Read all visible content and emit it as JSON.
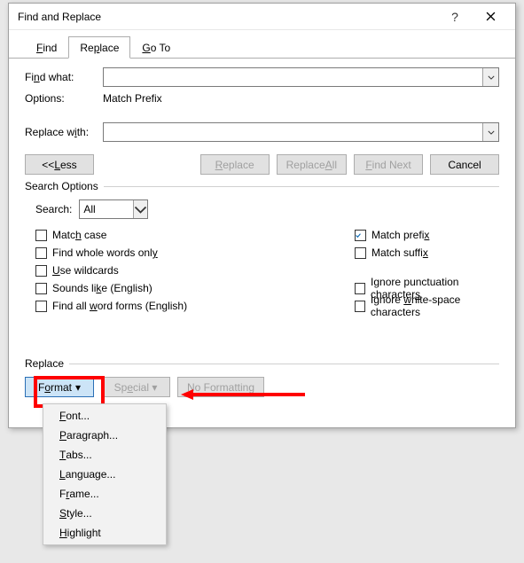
{
  "title": "Find and Replace",
  "tabs": {
    "find": "Find",
    "replace": "Replace",
    "goto": "Go To"
  },
  "findWhat": {
    "label": "Find what:",
    "value": ""
  },
  "optionsLabel": "Options:",
  "optionsValue": "Match Prefix",
  "replaceWith": {
    "label": "Replace with:",
    "value": ""
  },
  "buttons": {
    "less": "<< Less",
    "replace": "Replace",
    "replaceAll": "Replace All",
    "findNext": "Find Next",
    "cancel": "Cancel",
    "format": "Format",
    "special": "Special",
    "noFormatting": "No Formatting"
  },
  "searchOptionsLabel": "Search Options",
  "searchLabel": "Search:",
  "searchScope": "All",
  "checks": {
    "matchCase": "Match case",
    "wholeWords": "Find whole words only",
    "wildcards": "Use wildcards",
    "soundsLike": "Sounds like (English)",
    "wordForms": "Find all word forms (English)",
    "matchPrefix": "Match prefix",
    "matchSuffix": "Match suffix",
    "ignorePunct": "Ignore punctuation characters",
    "ignoreWhite": "Ignore white-space characters"
  },
  "replaceSection": "Replace",
  "menu": {
    "font": "Font...",
    "paragraph": "Paragraph...",
    "tabs": "Tabs...",
    "language": "Language...",
    "frame": "Frame...",
    "style": "Style...",
    "highlight": "Highlight"
  }
}
